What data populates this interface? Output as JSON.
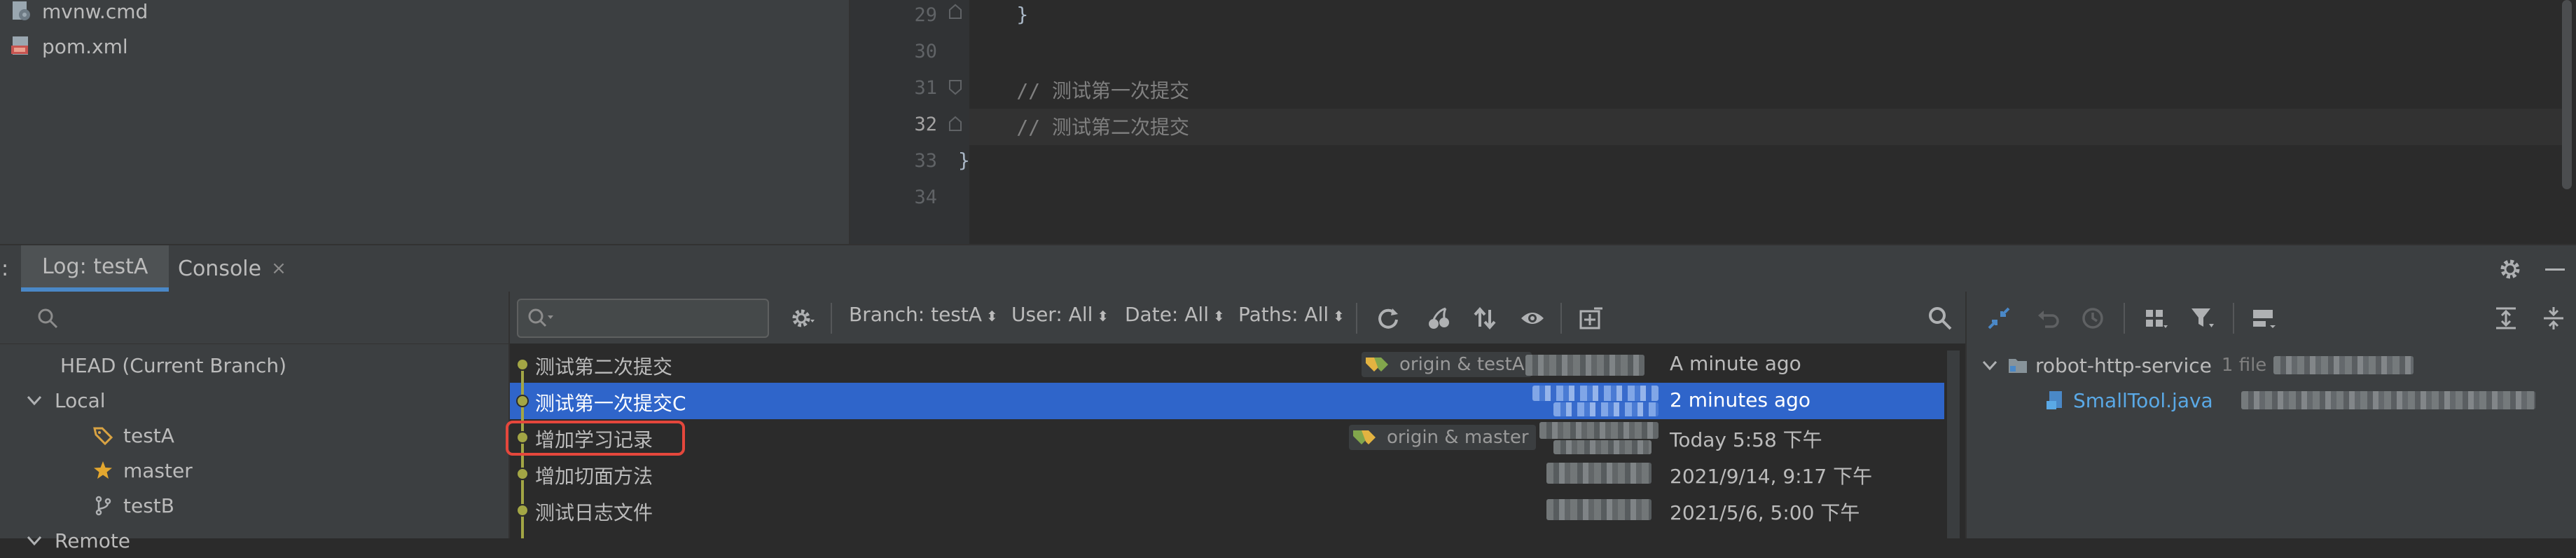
{
  "project_tree": {
    "files": [
      {
        "name": "mvnw.cmd",
        "icon": "cmd-file-icon"
      },
      {
        "name": "pom.xml",
        "icon": "maven-pom-icon"
      }
    ]
  },
  "editor": {
    "line_numbers": [
      "29",
      "30",
      "31",
      "32",
      "33",
      "34"
    ],
    "current_line": "32",
    "lines": [
      {
        "text": "    }",
        "type": "code"
      },
      {
        "text": "",
        "type": "code"
      },
      {
        "text": "    // 测试第一次提交",
        "type": "comment"
      },
      {
        "text": "    // 测试第二次提交",
        "type": "comment"
      },
      {
        "text": "}",
        "type": "code"
      },
      {
        "text": "",
        "type": "code"
      }
    ]
  },
  "tool_window": {
    "prefix": ":",
    "tabs": [
      {
        "label": "Log: testA",
        "active": true
      },
      {
        "label": "Console",
        "active": false,
        "closable": true
      }
    ],
    "close_glyph": "×"
  },
  "branches": {
    "items": [
      {
        "label": "HEAD (Current Branch)",
        "indent": 0,
        "icon": ""
      },
      {
        "label": "Local",
        "indent": 0,
        "icon": "chevron-down-icon"
      },
      {
        "label": "testA",
        "indent": 2,
        "icon": "tag-icon"
      },
      {
        "label": "master",
        "indent": 2,
        "icon": "star-icon"
      },
      {
        "label": "testB",
        "indent": 2,
        "icon": "branch-icon"
      },
      {
        "label": "Remote",
        "indent": 0,
        "icon": "chevron-down-icon"
      }
    ]
  },
  "log_toolbar": {
    "filters": [
      {
        "label": "Branch: testA"
      },
      {
        "label": "User: All"
      },
      {
        "label": "Date: All"
      },
      {
        "label": "Paths: All"
      }
    ],
    "chevron": "⬍"
  },
  "commits": [
    {
      "message": "测试第二次提交",
      "refs": "origin & testA",
      "date": "A minute ago",
      "selected": false
    },
    {
      "message": "测试第一次提交C",
      "refs": "",
      "date": "2 minutes ago",
      "selected": true
    },
    {
      "message": "增加学习记录",
      "refs": "origin & master",
      "date": "Today 5:58 下午",
      "selected": false
    },
    {
      "message": "增加切面方法",
      "refs": "",
      "date": "2021/9/14, 9:17 下午",
      "selected": false
    },
    {
      "message": "测试日志文件",
      "refs": "",
      "date": "2021/5/6, 5:00 下午",
      "selected": false
    }
  ],
  "changes": {
    "module": "robot-http-service",
    "module_count": "1 file",
    "file": "SmallTool.java"
  },
  "colors": {
    "accent": "#4a88c7",
    "selection": "#2f65ca",
    "graph": "#a3a645",
    "highlight_box": "#e5473c",
    "java_file": "#5aa9e6"
  }
}
